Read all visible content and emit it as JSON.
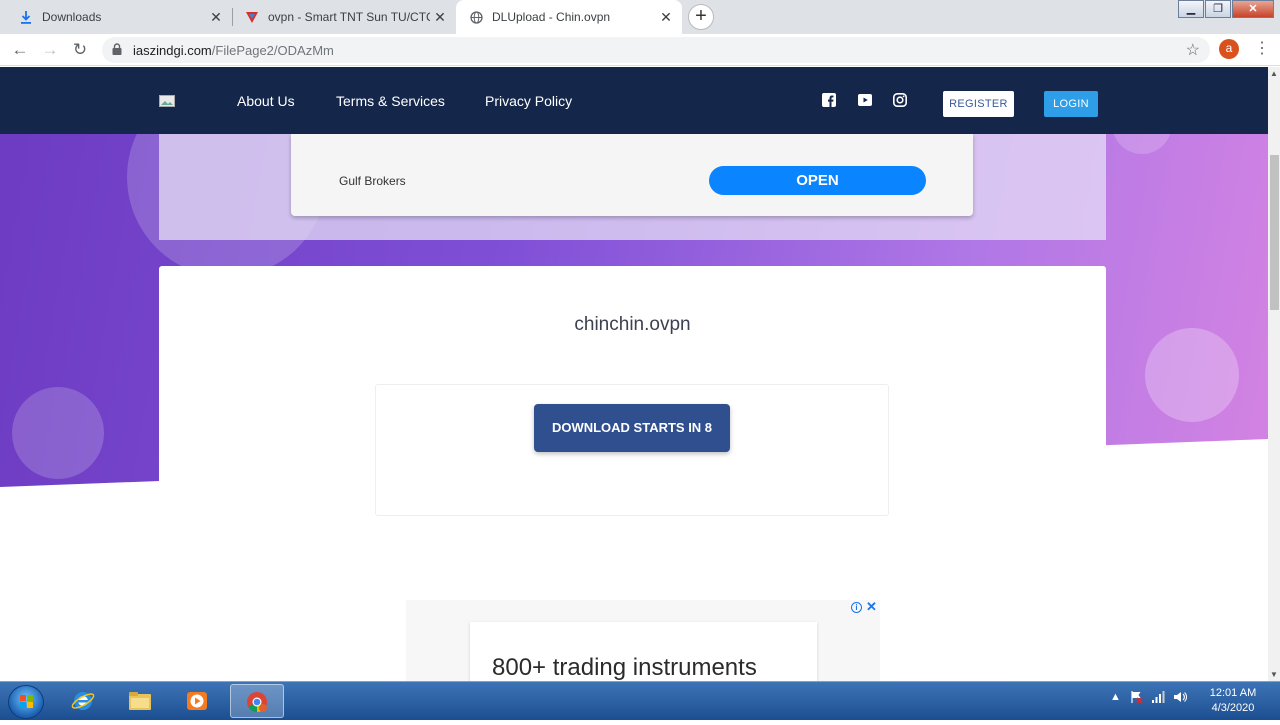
{
  "browser": {
    "tabs": [
      {
        "label": "Downloads",
        "icon": "download-icon",
        "active": false
      },
      {
        "label": "ovpn - Smart TNT Sun TU/CTC/G",
        "icon": "site-favicon",
        "active": false
      },
      {
        "label": "DLUpload - Chin.ovpn",
        "icon": "globe-icon",
        "active": true
      }
    ],
    "new_tab": "+",
    "url_host": "iaszindgi.com",
    "url_path": "/FilePage2/ODAzMm",
    "profile_initial": "a"
  },
  "site": {
    "nav": {
      "links": [
        "About Us",
        "Terms & Services",
        "Privacy Policy"
      ],
      "register": "REGISTER",
      "login": "LOGIN"
    },
    "top_ad": {
      "brand": "Gulf Brokers",
      "cta": "OPEN"
    },
    "file": {
      "name": "chinchin.ovpn",
      "download_label": "DOWNLOAD STARTS IN 8"
    },
    "bottom_ad": {
      "headline": "800+ trading instruments",
      "info": "i",
      "close": "✕"
    }
  },
  "taskbar": {
    "time": "12:01 AM",
    "date": "4/3/2020"
  },
  "colors": {
    "nav_bg": "#14264a",
    "download_button": "#2f4f8f",
    "open_button": "#0a84ff",
    "login_button": "#2f9ee8"
  }
}
